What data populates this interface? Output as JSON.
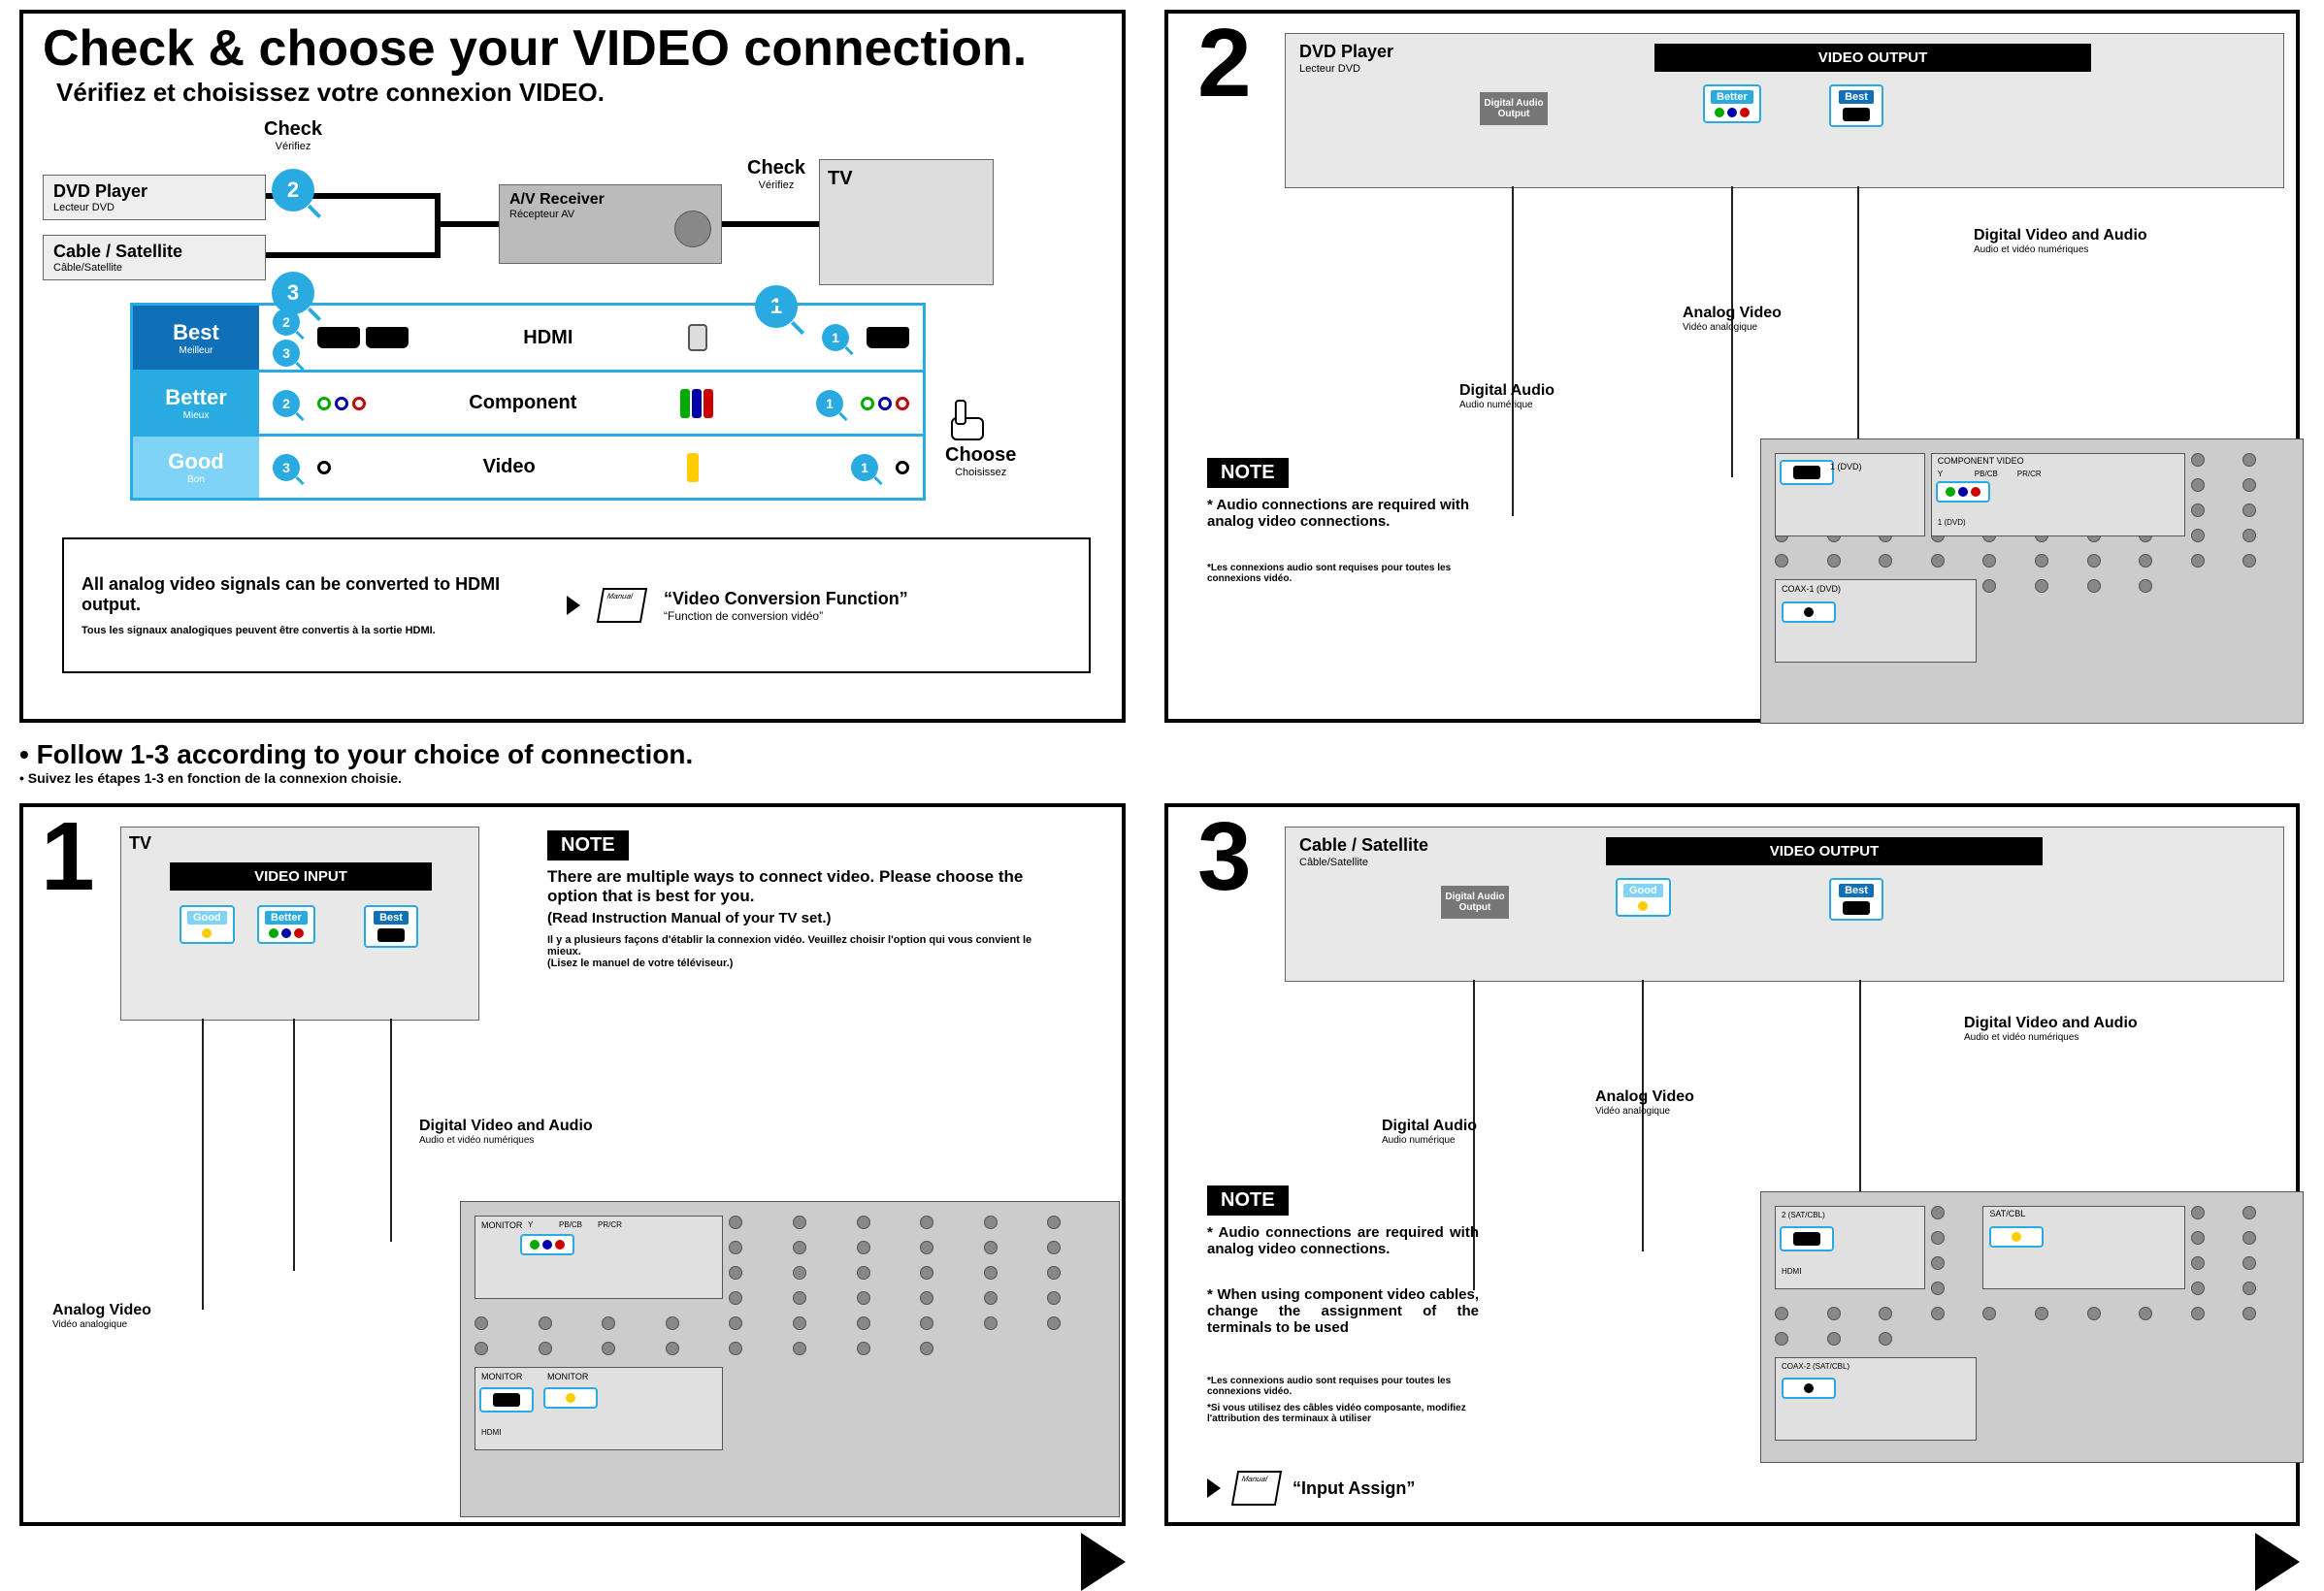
{
  "top": {
    "title_en": "Check & choose your VIDEO connection.",
    "title_fr": "Vérifiez et choisissez votre connexion VIDEO.",
    "check_lbl": "Check",
    "check_lbl_fr": "Vérifiez",
    "choose_lbl": "Choose",
    "choose_lbl_fr": "Choisissez",
    "devices": {
      "dvd": "DVD Player",
      "dvd_fr": "Lecteur DVD",
      "cable": "Cable / Satellite",
      "cable_fr": "Câble/Satellite",
      "avr": "A/V Receiver",
      "avr_fr": "Récepteur AV",
      "tv": "TV"
    },
    "checks": {
      "one": "1",
      "two": "2",
      "three": "3"
    },
    "quality": {
      "best": "Best",
      "best_fr": "Meilleur",
      "better": "Better",
      "better_fr": "Mieux",
      "good": "Good",
      "good_fr": "Bon",
      "hdmi": "HDMI",
      "component": "Component",
      "video": "Video"
    },
    "conv": {
      "line1_en": "All analog video signals can be converted to HDMI output.",
      "line1_fr": "Tous les signaux analogiques peuvent être convertis à la sortie HDMI.",
      "quote_en": "“Video Conversion Function”",
      "quote_fr": "“Function de conversion vidéo”"
    }
  },
  "follow": {
    "en": "• Follow 1-3 according to your choice of connection.",
    "fr": "• Suivez les étapes 1-3 en fonction de la connexion choisie."
  },
  "note_label": "NOTE",
  "labels_common": {
    "digital_av": "Digital Video and Audio",
    "digital_av_fr": "Audio et vidéo numériques",
    "analog_v": "Analog Video",
    "analog_v_fr": "Vidéo analogique",
    "digital_a": "Digital Audio",
    "digital_a_fr": "Audio numérique",
    "video_output": "VIDEO OUTPUT",
    "video_input": "VIDEO INPUT",
    "dao": "Digital Audio Output"
  },
  "step1": {
    "num": "1",
    "tv": "TV",
    "note1_en": "There are multiple ways to connect video. Please choose the option that is best for you.",
    "note2_en": "(Read Instruction Manual of your TV set.)",
    "note1_fr": "Il y a plusieurs façons d'établir la connexion vidéo. Veuillez choisir l'option qui vous convient le mieux.",
    "note2_fr": "(Lisez le manuel de votre téléviseur.)",
    "port_labels": {
      "monitor": "MONITOR",
      "y": "Y",
      "pb": "PB/CB",
      "pr": "PR/CR",
      "hdmi": "HDMI"
    }
  },
  "step2": {
    "num": "2",
    "device": "DVD Player",
    "device_fr": "Lecteur DVD",
    "note_en": "* Audio connections are required with analog video connections.",
    "note_fr": "*Les connexions audio sont requises pour toutes les connexions vidéo.",
    "back_labels": {
      "hdmi_port": "1 (DVD)",
      "comp": "COMPONENT VIDEO",
      "coax": "COAX-1 (DVD)"
    }
  },
  "step3": {
    "num": "3",
    "device": "Cable / Satellite",
    "device_fr": "Câble/Satellite",
    "note1_en": "* Audio connections are required with analog video connections.",
    "note2_en": "* When using component video cables, change the assignment of the terminals to be used",
    "note1_fr": "*Les connexions audio sont requises pour toutes les connexions vidéo.",
    "note2_fr": "*Si vous utilisez des câbles vidéo composante, modifiez l'attribution des terminaux à utiliser",
    "input_assign": "“Input Assign”",
    "back_labels": {
      "hdmi_port": "2 (SAT/CBL)",
      "sat": "SAT/CBL",
      "coax": "COAX-2 (SAT/CBL)"
    }
  }
}
